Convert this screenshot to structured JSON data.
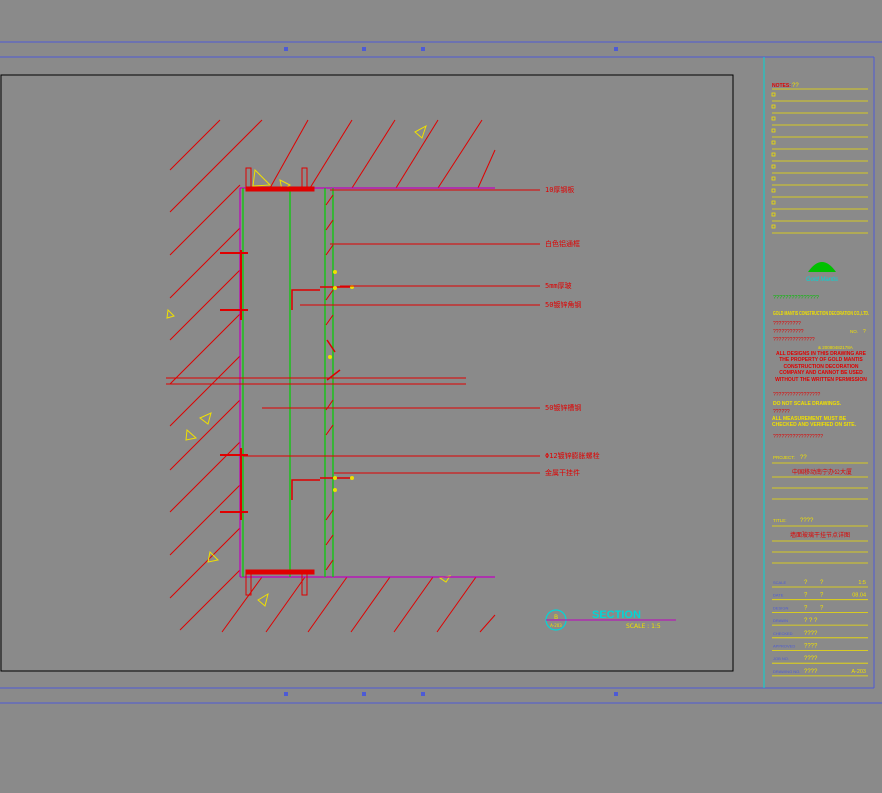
{
  "drawing": {
    "callouts": [
      {
        "text": "10厚钢板"
      },
      {
        "text": "白色铝通框"
      },
      {
        "text": "5mm厚玻"
      },
      {
        "text": "50镀锌角钢"
      },
      {
        "text": "50镀锌槽钢"
      },
      {
        "text": "Φ12镀锌膨胀螺栓"
      },
      {
        "text": "金属干挂件"
      }
    ],
    "section_marker": {
      "number": "B",
      "sheet": "A-203"
    },
    "section_title": "SECTION",
    "scale_text": "SCALE :  1:5"
  },
  "title_block": {
    "notes_label": "NOTES:",
    "notes_value": "??",
    "logo_text": "Gold Mantis",
    "company_cn": "???????????????",
    "company_en": "GOLD MANTIS CONSTRUCTION DECORATION CO.,LTD.",
    "garbled_1": "??????????",
    "garbled_2": "???????????",
    "no_label": "NO.",
    "no_value": "?",
    "garbled_3": "???????????????",
    "license": "& 20080482178A",
    "copyright_en": "ALL DESIGNS IN THIS DRAWING ARE THE PROPERTY OF GOLD MANTIS CONSTRUCTION DECORATION COMPANY AND CANNOT BE USED WITHOUT THE WRITTEN PERMISSION",
    "garbled_4": "?????????????????",
    "noscale": "DO NOT SCALE DRAWINGS.",
    "garbled_5": "??????",
    "verify": "ALL MEASUREMENT MUST BE CHECKED AND VERIFIED ON SITE.",
    "garbled_6": "??????????????????",
    "project_label": "PROJECT:",
    "project_value": "??",
    "project_name": "中国移动南宁办公大厦",
    "title_label": "TITLE:",
    "title_value": "????",
    "title_name": "墙面玻璃干挂节点详图",
    "rows": [
      {
        "label": "SCALE",
        "a": "?",
        "b": "?",
        "c": "1:5"
      },
      {
        "label": "DATE",
        "a": "?",
        "b": "?",
        "c": "08.04"
      },
      {
        "label": "DESIGN",
        "a": "?",
        "b": "?",
        "c": ""
      },
      {
        "label": "DRAWN",
        "a": "? ? ?",
        "b": "",
        "c": ""
      },
      {
        "label": "CHECKED",
        "a": "????",
        "b": "",
        "c": ""
      },
      {
        "label": "APPROVED",
        "a": "????",
        "b": "",
        "c": ""
      },
      {
        "label": "JOB NO.",
        "a": "????",
        "b": "",
        "c": ""
      },
      {
        "label": "DRAWING NO.",
        "a": "????",
        "b": "",
        "c": "A-203"
      }
    ]
  }
}
